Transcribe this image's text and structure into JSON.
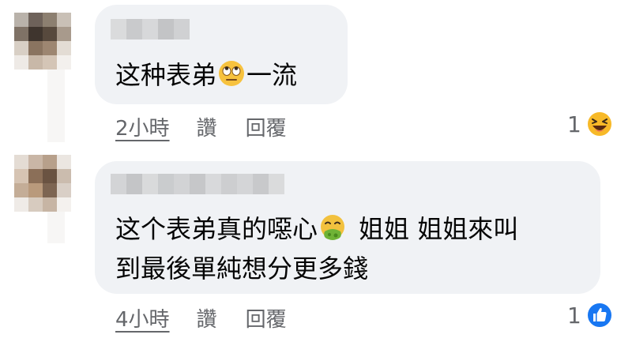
{
  "comments": [
    {
      "text": "这种表弟",
      "text_after_emoji": "一流",
      "emoji": "eye-roll-face-icon",
      "timestamp": "2小時",
      "like_label": "讚",
      "reply_label": "回覆",
      "reaction_count": "1",
      "reaction_type": "haha-reaction-icon"
    },
    {
      "text_line1_before": "这个表弟真的噁心",
      "text_line1_after": "姐姐 姐姐來叫",
      "text_line2": "到最後單純想分更多錢",
      "emoji": "nauseated-face-icon",
      "timestamp": "4小時",
      "like_label": "讚",
      "reply_label": "回覆",
      "reaction_count": "1",
      "reaction_type": "like-reaction-icon"
    }
  ],
  "colors": {
    "bubble": "#f0f2f5",
    "secondary_text": "#65676b",
    "like_blue": "#1877f2",
    "haha_yellow": "#f7b928"
  }
}
